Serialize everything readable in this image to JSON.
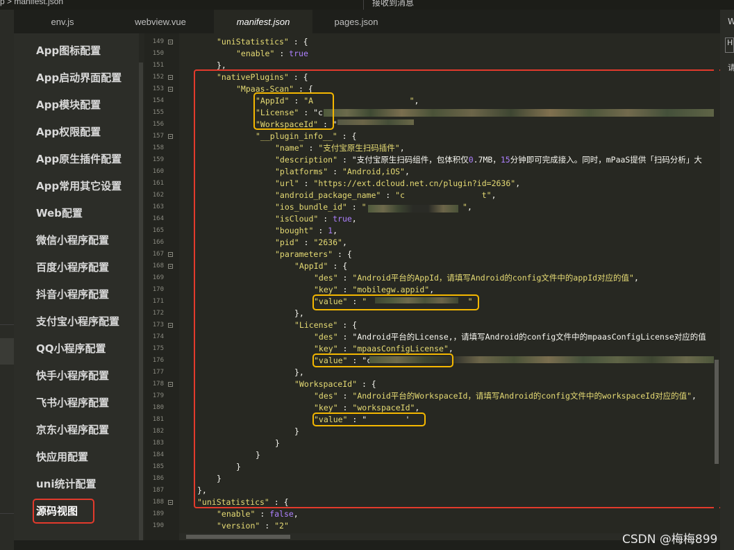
{
  "breadcrumb": "p > manifest.json",
  "notification": "接收到消息",
  "tabs": [
    {
      "label": "env.js"
    },
    {
      "label": "webview.vue"
    },
    {
      "label": "manifest.json"
    },
    {
      "label": "pages.json"
    }
  ],
  "nav": [
    {
      "label": "App图标配置"
    },
    {
      "label": "App启动界面配置"
    },
    {
      "label": "App模块配置"
    },
    {
      "label": "App权限配置"
    },
    {
      "label": "App原生插件配置"
    },
    {
      "label": "App常用其它设置"
    },
    {
      "label": "Web配置"
    },
    {
      "label": "微信小程序配置"
    },
    {
      "label": "百度小程序配置"
    },
    {
      "label": "抖音小程序配置"
    },
    {
      "label": "支付宝小程序配置"
    },
    {
      "label": "QQ小程序配置"
    },
    {
      "label": "快手小程序配置"
    },
    {
      "label": "飞书小程序配置"
    },
    {
      "label": "京东小程序配置"
    },
    {
      "label": "快应用配置"
    },
    {
      "label": "uni统计配置"
    },
    {
      "label": "源码视图"
    }
  ],
  "line_numbers": [
    "149",
    "150",
    "151",
    "152",
    "153",
    "154",
    "155",
    "156",
    "157",
    "158",
    "159",
    "160",
    "161",
    "162",
    "163",
    "164",
    "165",
    "166",
    "167",
    "168",
    "169",
    "170",
    "171",
    "172",
    "173",
    "174",
    "175",
    "176",
    "177",
    "178",
    "179",
    "180",
    "181",
    "182",
    "183",
    "184",
    "185",
    "186",
    "187",
    "188",
    "189",
    "190"
  ],
  "code": {
    "l149": "\"uniStatistics\" : {",
    "l150": "\"enable\" : true",
    "l151": "},",
    "l152": "\"nativePlugins\" : {",
    "l153": "\"Mpaas-Scan\" : {",
    "l154": "\"AppId\" : \"A                    \",",
    "l155": "\"License\" : \"c",
    "l156": "\"WorkspaceId\" : \"",
    "l157": "\"__plugin_info__\" : {",
    "l158": "\"name\" : \"支付宝原生扫码插件\",",
    "l159": "\"description\" : \"支付宝原生扫码组件，包体积仅0.7MB，15分钟即可完成接入。同时，mPaaS提供「扫码分析」大",
    "l160": "\"platforms\" : \"Android,iOS\",",
    "l161": "\"url\" : \"https://ext.dcloud.net.cn/plugin?id=2636\",",
    "l162": "\"android_package_name\" : \"c                t\",",
    "l163": "\"ios_bundle_id\" : \"                    \",",
    "l164": "\"isCloud\" : true,",
    "l165": "\"bought\" : 1,",
    "l166": "\"pid\" : \"2636\",",
    "l167": "\"parameters\" : {",
    "l168": "\"AppId\" : {",
    "l169": "\"des\" : \"Android平台的AppId，请填写Android的config文件中的appId对应的值\",",
    "l170": "\"key\" : \"mobilegw.appid\",",
    "l171": "\"value\" : \"                     \"",
    "l172": "},",
    "l173": "\"License\" : {",
    "l174": "\"des\" : \"Android平台的License,，请填写Android的config文件中的mpaasConfigLicense对应的值",
    "l175": "\"key\" : \"mpaasConfigLicense\",",
    "l176": "\"value\" : \"c",
    "l177": "},",
    "l178": "\"WorkspaceId\" : {",
    "l179": "\"des\" : \"Android平台的WorkspaceId，请填写Android的config文件中的workspaceId对应的值\",",
    "l180": "\"key\" : \"workspaceId\",",
    "l181": "\"value\" : \"        '",
    "l182": "}",
    "l183": "}",
    "l184": "}",
    "l185": "}",
    "l186": "}",
    "l187": "},",
    "l188": "\"uniStatistics\" : {",
    "l189": "\"enable\" : false,",
    "l190": "\"version\" : \"2\""
  },
  "right_panel": {
    "title": "W",
    "input": "H",
    "label": "请"
  },
  "watermark": "CSDN @梅梅899"
}
